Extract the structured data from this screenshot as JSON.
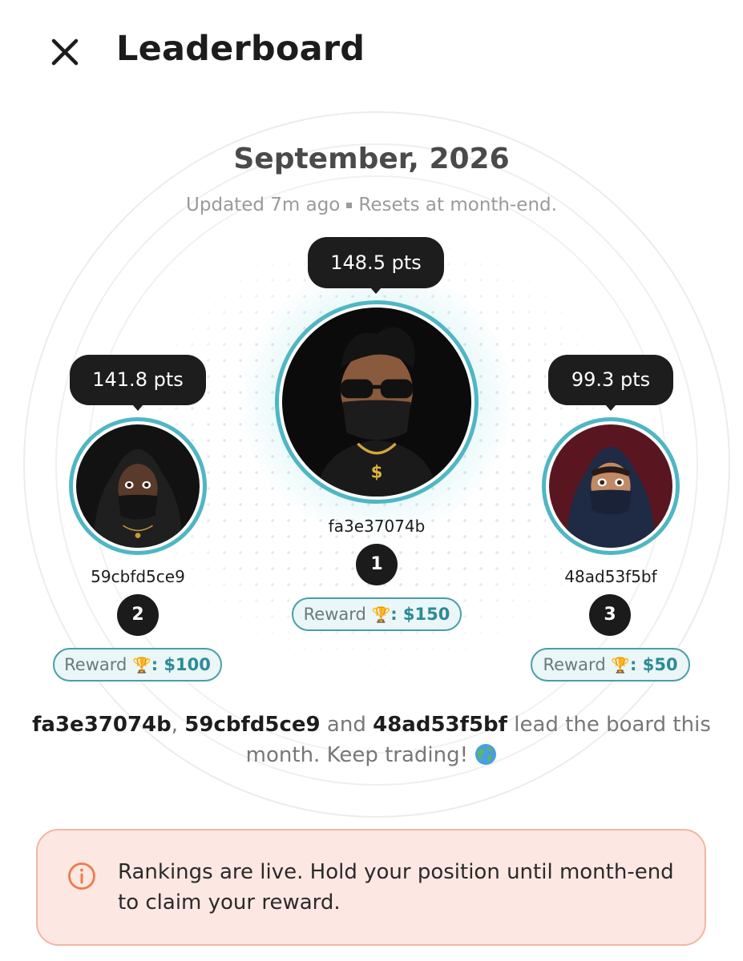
{
  "header": {
    "title": "Leaderboard",
    "close_icon": "close-icon"
  },
  "period": {
    "month": "September, 2026",
    "updated": "Updated 7m ago",
    "resets": "Resets at month-end."
  },
  "podium": [
    {
      "rank": "1",
      "user": "fa3e37074b",
      "points": "148.5 pts",
      "reward_label": "Reward",
      "reward_icon": "🏆",
      "reward_amount": ": $150"
    },
    {
      "rank": "2",
      "user": "59cbfd5ce9",
      "points": "141.8 pts",
      "reward_label": "Reward",
      "reward_icon": "🏆",
      "reward_amount": ": $100"
    },
    {
      "rank": "3",
      "user": "48ad53f5bf",
      "points": "99.3 pts",
      "reward_label": "Reward",
      "reward_icon": "🏆",
      "reward_amount": ": $50"
    }
  ],
  "summary": {
    "user1": "fa3e37074b",
    "comma": ", ",
    "user2": "59cbfd5ce9",
    "and": " and ",
    "user3": "48ad53f5bf",
    "tail": " lead the board this month. Keep trading!",
    "icon": "globe-icon"
  },
  "notice": {
    "icon": "info-icon",
    "text": "Rankings are live. Hold your position until month-end to claim your reward."
  },
  "colors": {
    "accent": "#4fb6c4",
    "reward_text": "#2d8a96",
    "notice_bg": "#fde7e2",
    "notice_border": "#f1b6a4",
    "info_icon": "#ef7a4b"
  }
}
